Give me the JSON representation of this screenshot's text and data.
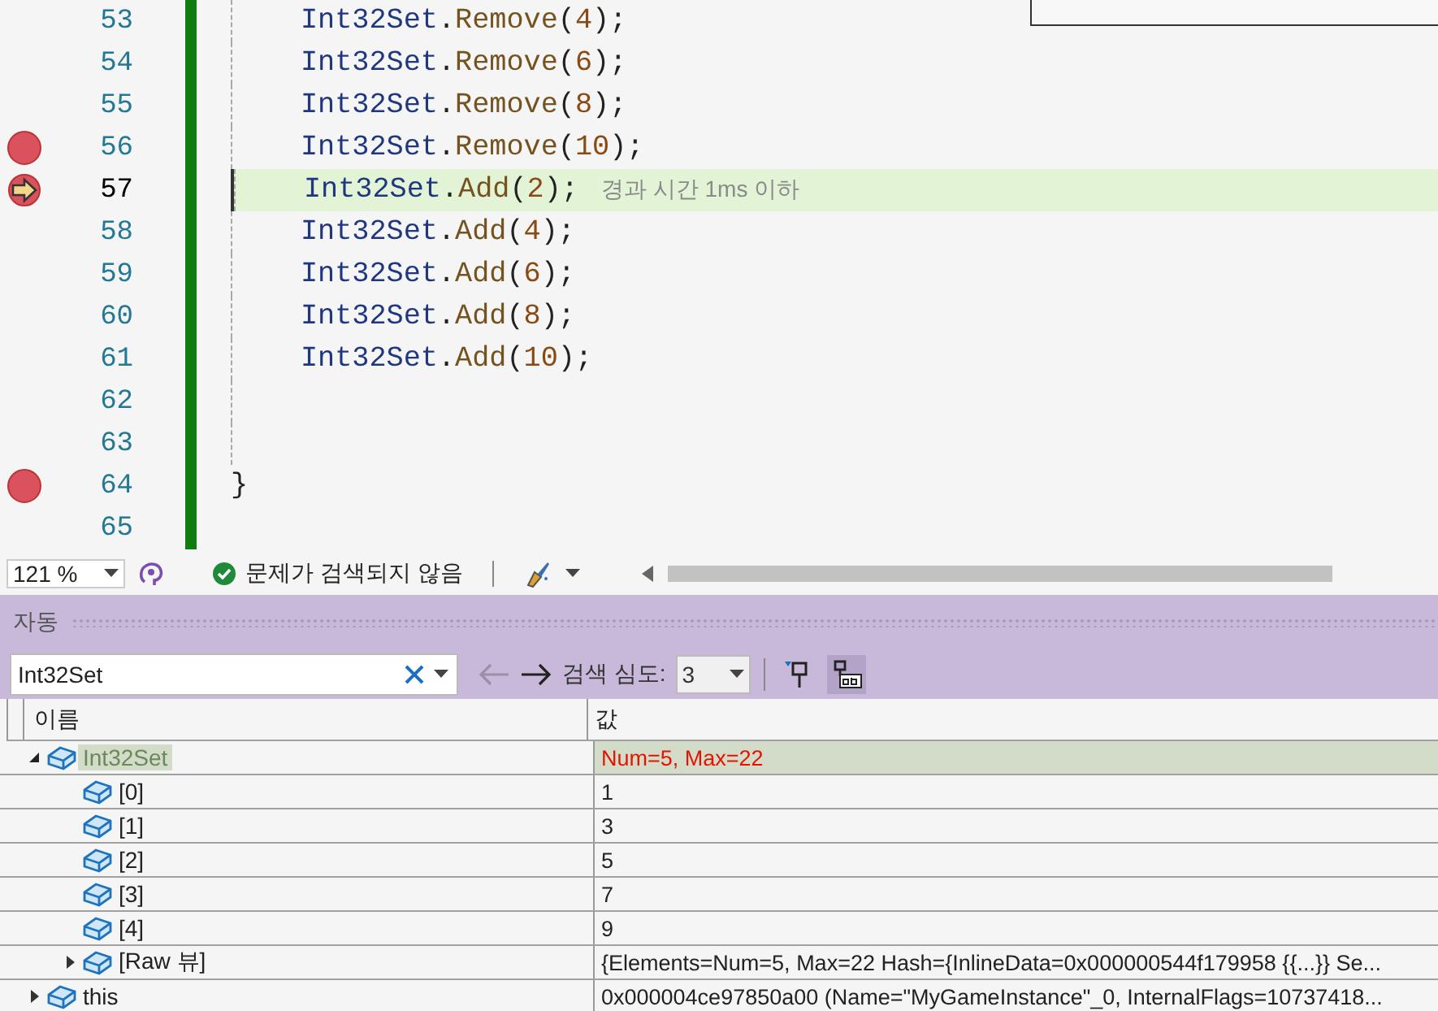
{
  "editor": {
    "lines": [
      {
        "number": "53",
        "breakpoint": false,
        "current": false,
        "indent": true,
        "tokens": [
          {
            "text": "Int32Set",
            "kind": "ident"
          },
          {
            "text": ".",
            "kind": "punct"
          },
          {
            "text": "Remove",
            "kind": "method"
          },
          {
            "text": "(",
            "kind": "punct"
          },
          {
            "text": "4",
            "kind": "number"
          },
          {
            "text": ");",
            "kind": "punct"
          }
        ]
      },
      {
        "number": "54",
        "breakpoint": false,
        "current": false,
        "indent": true,
        "tokens": [
          {
            "text": "Int32Set",
            "kind": "ident"
          },
          {
            "text": ".",
            "kind": "punct"
          },
          {
            "text": "Remove",
            "kind": "method"
          },
          {
            "text": "(",
            "kind": "punct"
          },
          {
            "text": "6",
            "kind": "number"
          },
          {
            "text": ");",
            "kind": "punct"
          }
        ]
      },
      {
        "number": "55",
        "breakpoint": false,
        "current": false,
        "indent": true,
        "tokens": [
          {
            "text": "Int32Set",
            "kind": "ident"
          },
          {
            "text": ".",
            "kind": "punct"
          },
          {
            "text": "Remove",
            "kind": "method"
          },
          {
            "text": "(",
            "kind": "punct"
          },
          {
            "text": "8",
            "kind": "number"
          },
          {
            "text": ");",
            "kind": "punct"
          }
        ]
      },
      {
        "number": "56",
        "breakpoint": true,
        "current": false,
        "indent": true,
        "tokens": [
          {
            "text": "Int32Set",
            "kind": "ident"
          },
          {
            "text": ".",
            "kind": "punct"
          },
          {
            "text": "Remove",
            "kind": "method"
          },
          {
            "text": "(",
            "kind": "punct"
          },
          {
            "text": "10",
            "kind": "number"
          },
          {
            "text": ");",
            "kind": "punct"
          }
        ]
      },
      {
        "number": "57",
        "breakpoint": true,
        "current": true,
        "indent": true,
        "hint": "경과 시간 1ms 이하",
        "tokens": [
          {
            "text": "Int32Set",
            "kind": "ident"
          },
          {
            "text": ".",
            "kind": "punct"
          },
          {
            "text": "Add",
            "kind": "method"
          },
          {
            "text": "(",
            "kind": "punct"
          },
          {
            "text": "2",
            "kind": "number"
          },
          {
            "text": ");",
            "kind": "punct"
          }
        ]
      },
      {
        "number": "58",
        "breakpoint": false,
        "current": false,
        "indent": true,
        "tokens": [
          {
            "text": "Int32Set",
            "kind": "ident"
          },
          {
            "text": ".",
            "kind": "punct"
          },
          {
            "text": "Add",
            "kind": "method"
          },
          {
            "text": "(",
            "kind": "punct"
          },
          {
            "text": "4",
            "kind": "number"
          },
          {
            "text": ");",
            "kind": "punct"
          }
        ]
      },
      {
        "number": "59",
        "breakpoint": false,
        "current": false,
        "indent": true,
        "tokens": [
          {
            "text": "Int32Set",
            "kind": "ident"
          },
          {
            "text": ".",
            "kind": "punct"
          },
          {
            "text": "Add",
            "kind": "method"
          },
          {
            "text": "(",
            "kind": "punct"
          },
          {
            "text": "6",
            "kind": "number"
          },
          {
            "text": ");",
            "kind": "punct"
          }
        ]
      },
      {
        "number": "60",
        "breakpoint": false,
        "current": false,
        "indent": true,
        "tokens": [
          {
            "text": "Int32Set",
            "kind": "ident"
          },
          {
            "text": ".",
            "kind": "punct"
          },
          {
            "text": "Add",
            "kind": "method"
          },
          {
            "text": "(",
            "kind": "punct"
          },
          {
            "text": "8",
            "kind": "number"
          },
          {
            "text": ");",
            "kind": "punct"
          }
        ]
      },
      {
        "number": "61",
        "breakpoint": false,
        "current": false,
        "indent": true,
        "tokens": [
          {
            "text": "Int32Set",
            "kind": "ident"
          },
          {
            "text": ".",
            "kind": "punct"
          },
          {
            "text": "Add",
            "kind": "method"
          },
          {
            "text": "(",
            "kind": "punct"
          },
          {
            "text": "10",
            "kind": "number"
          },
          {
            "text": ");",
            "kind": "punct"
          }
        ]
      },
      {
        "number": "62",
        "breakpoint": false,
        "current": false,
        "indent": true
      },
      {
        "number": "63",
        "breakpoint": false,
        "current": false,
        "indent": true
      },
      {
        "number": "64",
        "breakpoint": true,
        "current": false,
        "indent": false,
        "tokens": [
          {
            "text": "}",
            "kind": "punct"
          }
        ]
      },
      {
        "number": "65",
        "breakpoint": false,
        "current": false,
        "indent": false
      }
    ]
  },
  "status_bar": {
    "zoom": "121 %",
    "issues": "문제가 검색되지 않음"
  },
  "autos": {
    "title": "자동",
    "search": {
      "value": "Int32Set"
    },
    "depth_label": "검색 심도:",
    "depth": "3",
    "columns": [
      "이름",
      "값"
    ],
    "rows": [
      {
        "kind": "group",
        "name": "Int32Set",
        "value": "Num=5, Max=22",
        "expanded": true,
        "selected": true,
        "changed": true,
        "children": [
          {
            "kind": "item",
            "name": "[0]",
            "value": "1",
            "selected": false,
            "changed": false
          },
          {
            "kind": "item",
            "name": "[1]",
            "value": "3",
            "selected": false,
            "changed": false
          },
          {
            "kind": "item",
            "name": "[2]",
            "value": "5",
            "selected": false,
            "changed": false
          },
          {
            "kind": "item",
            "name": "[3]",
            "value": "7",
            "selected": false,
            "changed": false
          },
          {
            "kind": "item",
            "name": "[4]",
            "value": "9",
            "selected": false,
            "changed": false
          },
          {
            "kind": "group",
            "name": "[Raw 뷰]",
            "value": "{Elements=Num=5, Max=22 Hash={InlineData=0x000000544f179958 {{...}} Se...",
            "expanded": false,
            "selected": false,
            "changed": false
          }
        ]
      },
      {
        "kind": "group",
        "name": "this",
        "value": "0x000004ce97850a00 (Name=\"MyGameInstance\"_0, InternalFlags=10737418...",
        "expanded": false,
        "selected": false,
        "changed": false
      }
    ]
  }
}
